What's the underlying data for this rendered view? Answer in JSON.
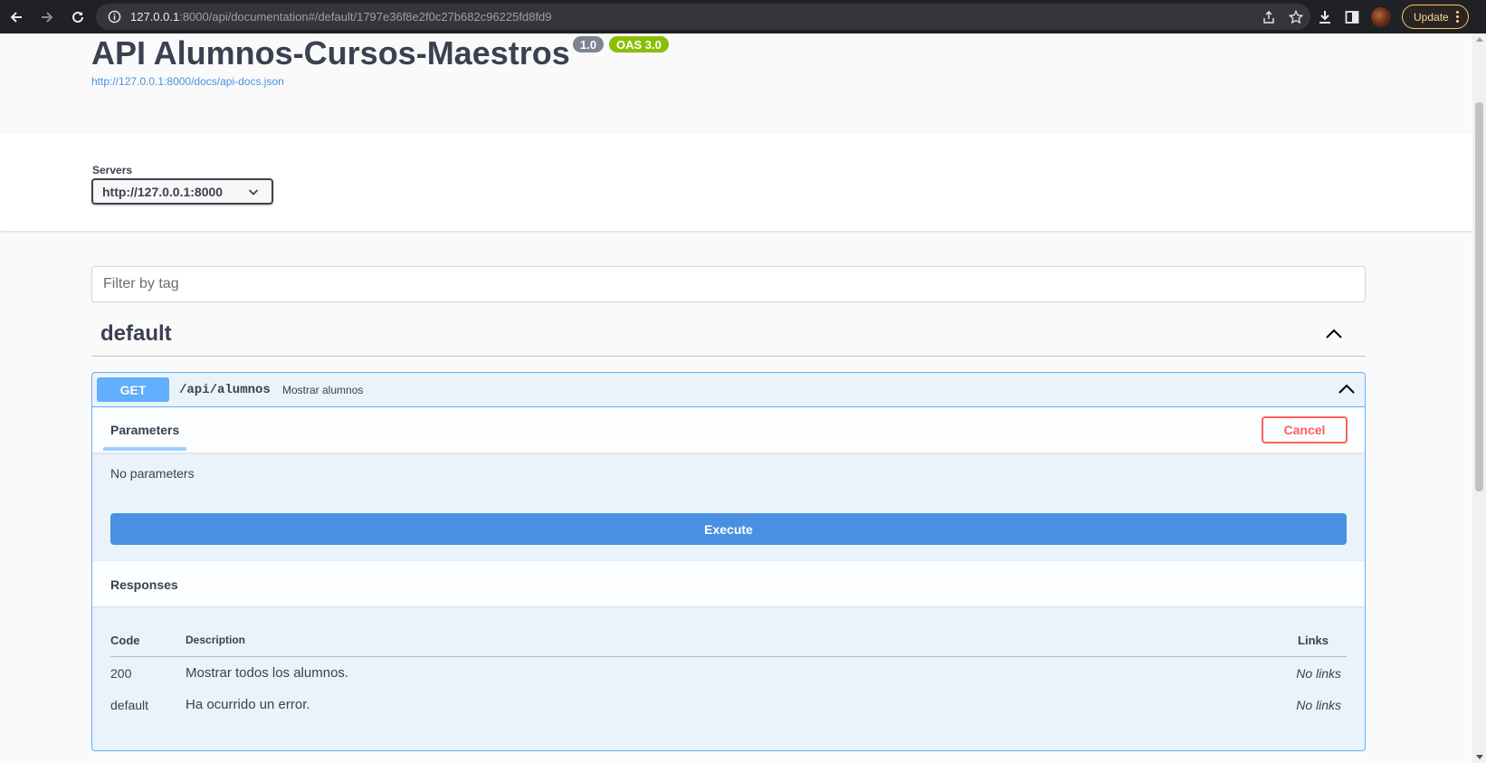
{
  "browser": {
    "url_host": "127.0.0.1",
    "url_rest": ":8000/api/documentation#/default/1797e36f8e2f0c27b682c96225fd8fd9",
    "update_label": "Update"
  },
  "info": {
    "title": "API Alumnos-Cursos-Maestros",
    "version": "1.0",
    "oas": "OAS 3.0",
    "spec_url": "http://127.0.0.1:8000/docs/api-docs.json"
  },
  "servers": {
    "label": "Servers",
    "selected": "http://127.0.0.1:8000"
  },
  "filter": {
    "placeholder": "Filter by tag"
  },
  "tag": {
    "name": "default"
  },
  "operation": {
    "method": "GET",
    "path": "/api/alumnos",
    "summary": "Mostrar alumnos",
    "parameters_tab": "Parameters",
    "cancel_label": "Cancel",
    "no_parameters": "No parameters",
    "execute_label": "Execute",
    "responses_title": "Responses",
    "responses_columns": {
      "code": "Code",
      "description": "Description",
      "links": "Links"
    },
    "responses": [
      {
        "code": "200",
        "description": "Mostrar todos los alumnos.",
        "links": "No links"
      },
      {
        "code": "default",
        "description": "Ha ocurrido un error.",
        "links": "No links"
      }
    ]
  },
  "colors": {
    "get": "#61affe",
    "execute": "#4990e2",
    "cancel": "#ff6060",
    "oas_badge": "#89bf04",
    "version_badge": "#7d8492"
  },
  "icons": [
    "back-arrow-icon",
    "forward-arrow-icon",
    "reload-icon",
    "info-icon",
    "share-icon",
    "star-icon",
    "download-icon",
    "side-panel-icon",
    "chevron-down-icon",
    "chevron-up-icon",
    "kebab-menu-icon"
  ]
}
